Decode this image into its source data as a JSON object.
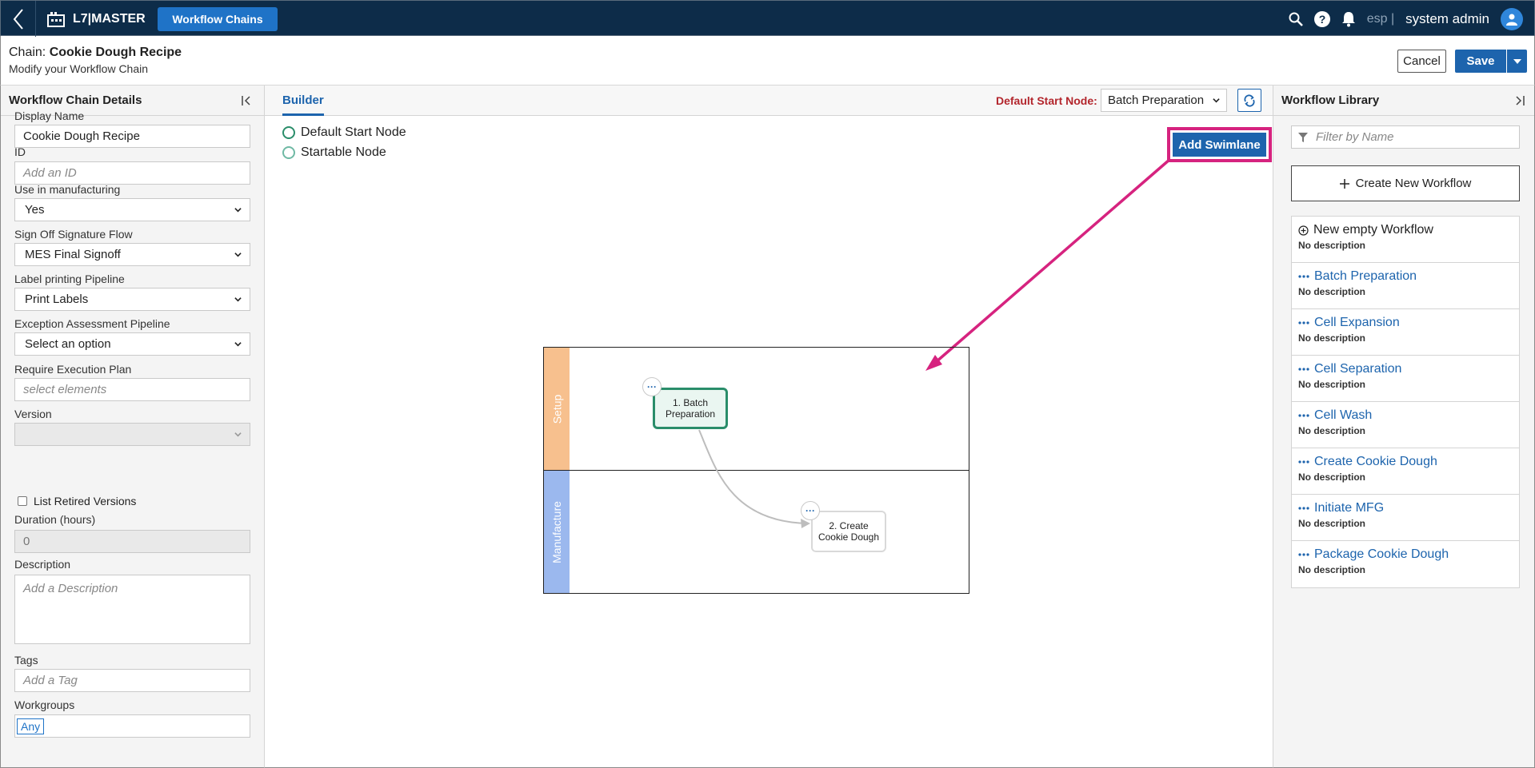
{
  "app": {
    "name": "L7|MASTER",
    "nav_chip": "Workflow Chains",
    "lang": "esp |",
    "user": "system admin"
  },
  "header": {
    "chain_prefix": "Chain: ",
    "chain_name": "Cookie Dough Recipe",
    "subtitle": "Modify your Workflow Chain",
    "cancel": "Cancel",
    "save": "Save"
  },
  "left": {
    "title": "Workflow Chain Details",
    "fields": {
      "display_name": {
        "label": "Display Name",
        "value": "Cookie Dough Recipe"
      },
      "id": {
        "label": "ID",
        "placeholder": "Add an ID"
      },
      "use_in_mfg": {
        "label": "Use in manufacturing",
        "value": "Yes"
      },
      "signoff": {
        "label": "Sign Off Signature Flow",
        "value": "MES Final Signoff"
      },
      "label_pipeline": {
        "label": "Label printing Pipeline",
        "value": "Print Labels"
      },
      "exception_pipeline": {
        "label": "Exception Assessment Pipeline",
        "value": "Select an option"
      },
      "exec_plan": {
        "label": "Require Execution Plan",
        "placeholder": "select elements"
      },
      "version": {
        "label": "Version",
        "value": ""
      },
      "retired": {
        "label": "List Retired Versions"
      },
      "duration": {
        "label": "Duration (hours)",
        "value": "0"
      },
      "description": {
        "label": "Description",
        "placeholder": "Add a Description"
      },
      "tags": {
        "label": "Tags",
        "placeholder": "Add a Tag"
      },
      "workgroups": {
        "label": "Workgroups",
        "value": "Any"
      }
    }
  },
  "builder": {
    "tab": "Builder",
    "default_start_label": "Default Start Node:",
    "default_start_value": "Batch Preparation",
    "legend": {
      "default_start": "Default Start Node",
      "startable": "Startable Node"
    },
    "add_swimlane": "Add Swimlane",
    "lanes": [
      {
        "name": "Setup",
        "color": "#f7c08e"
      },
      {
        "name": "Manufacture",
        "color": "#9bb8ee"
      }
    ],
    "nodes": [
      {
        "label": "1. Batch Preparation",
        "dots": "···"
      },
      {
        "label": "2. Create Cookie Dough",
        "dots": "···"
      }
    ],
    "highlight_color": "#d6237f"
  },
  "right": {
    "title": "Workflow Library",
    "filter_placeholder": "Filter by Name",
    "create_label": "Create New Workflow",
    "items": [
      {
        "name": "New empty Workflow",
        "desc": "No description"
      },
      {
        "name": "Batch Preparation",
        "desc": "No description"
      },
      {
        "name": "Cell Expansion",
        "desc": "No description"
      },
      {
        "name": "Cell Separation",
        "desc": "No description"
      },
      {
        "name": "Cell Wash",
        "desc": "No description"
      },
      {
        "name": "Create Cookie Dough",
        "desc": "No description"
      },
      {
        "name": "Initiate MFG",
        "desc": "No description"
      },
      {
        "name": "Package Cookie Dough",
        "desc": "No description"
      }
    ]
  }
}
